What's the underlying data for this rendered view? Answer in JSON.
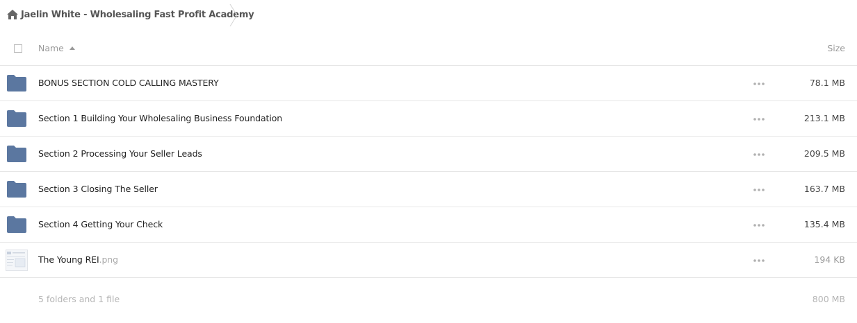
{
  "breadcrumb": {
    "icon": "home-icon",
    "label": "Jaelin White - Wholesaling Fast Profit Academy"
  },
  "header": {
    "name_label": "Name",
    "size_label": "Size",
    "sort": "ascending"
  },
  "colors": {
    "folder": "#5b77a0",
    "divider": "#e6e6e6",
    "muted_text": "#999999"
  },
  "items": [
    {
      "type": "folder",
      "name": "BONUS SECTION COLD CALLING MASTERY",
      "ext": "",
      "size": "78.1 MB"
    },
    {
      "type": "folder",
      "name": "Section 1 Building Your Wholesaling Business Foundation",
      "ext": "",
      "size": "213.1 MB"
    },
    {
      "type": "folder",
      "name": "Section 2 Processing Your Seller Leads",
      "ext": "",
      "size": "209.5 MB"
    },
    {
      "type": "folder",
      "name": "Section 3 Closing The Seller",
      "ext": "",
      "size": "163.7 MB"
    },
    {
      "type": "folder",
      "name": "Section 4 Getting Your Check",
      "ext": "",
      "size": "135.4 MB"
    },
    {
      "type": "file",
      "name": "The Young REI",
      "ext": ".png",
      "size": "194 KB"
    }
  ],
  "footer": {
    "summary": "5 folders and 1 file",
    "total": "800 MB"
  }
}
